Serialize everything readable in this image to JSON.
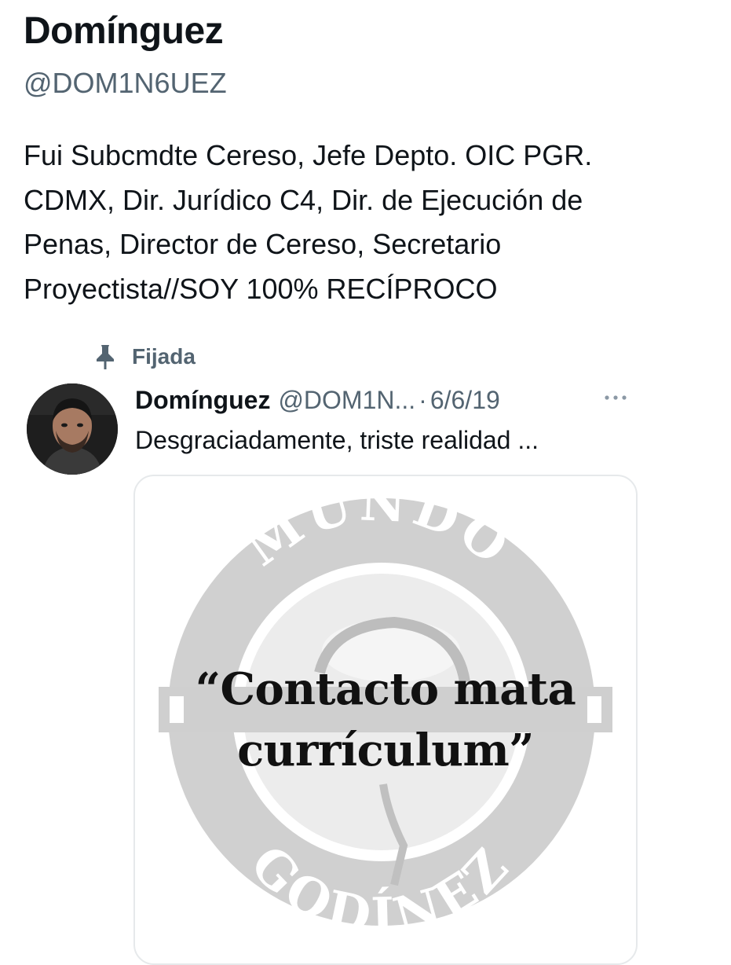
{
  "profile": {
    "name": "Domínguez",
    "handle": "@DOM1N6UEZ",
    "bio": "Fui Subcmdte Cereso, Jefe Depto. OIC PGR.\nCDMX, Dir. Jurídico C4, Dir. de Ejecución de\nPenas, Director de Cereso, Secretario\nProyectista//SOY 100% RECÍPROCO"
  },
  "pinned": {
    "label": "Fijada",
    "icon": "pin-icon"
  },
  "tweet": {
    "author": "Domínguez",
    "handle": "@DOM1N...",
    "separator": "·",
    "date": "6/6/19",
    "more_icon": "more-icon",
    "text": "Desgraciadamente, triste realidad ...",
    "media": {
      "logo_text_top": "MUNDO",
      "logo_text_bottom": "GODÍNEZ",
      "meme_line1": "“Contacto mata",
      "meme_line2": "currículum”"
    }
  },
  "colors": {
    "text_primary": "#0f1419",
    "text_secondary": "#536471",
    "logo_gray": "#c9c9c9",
    "card_border": "#e6e9eb"
  }
}
